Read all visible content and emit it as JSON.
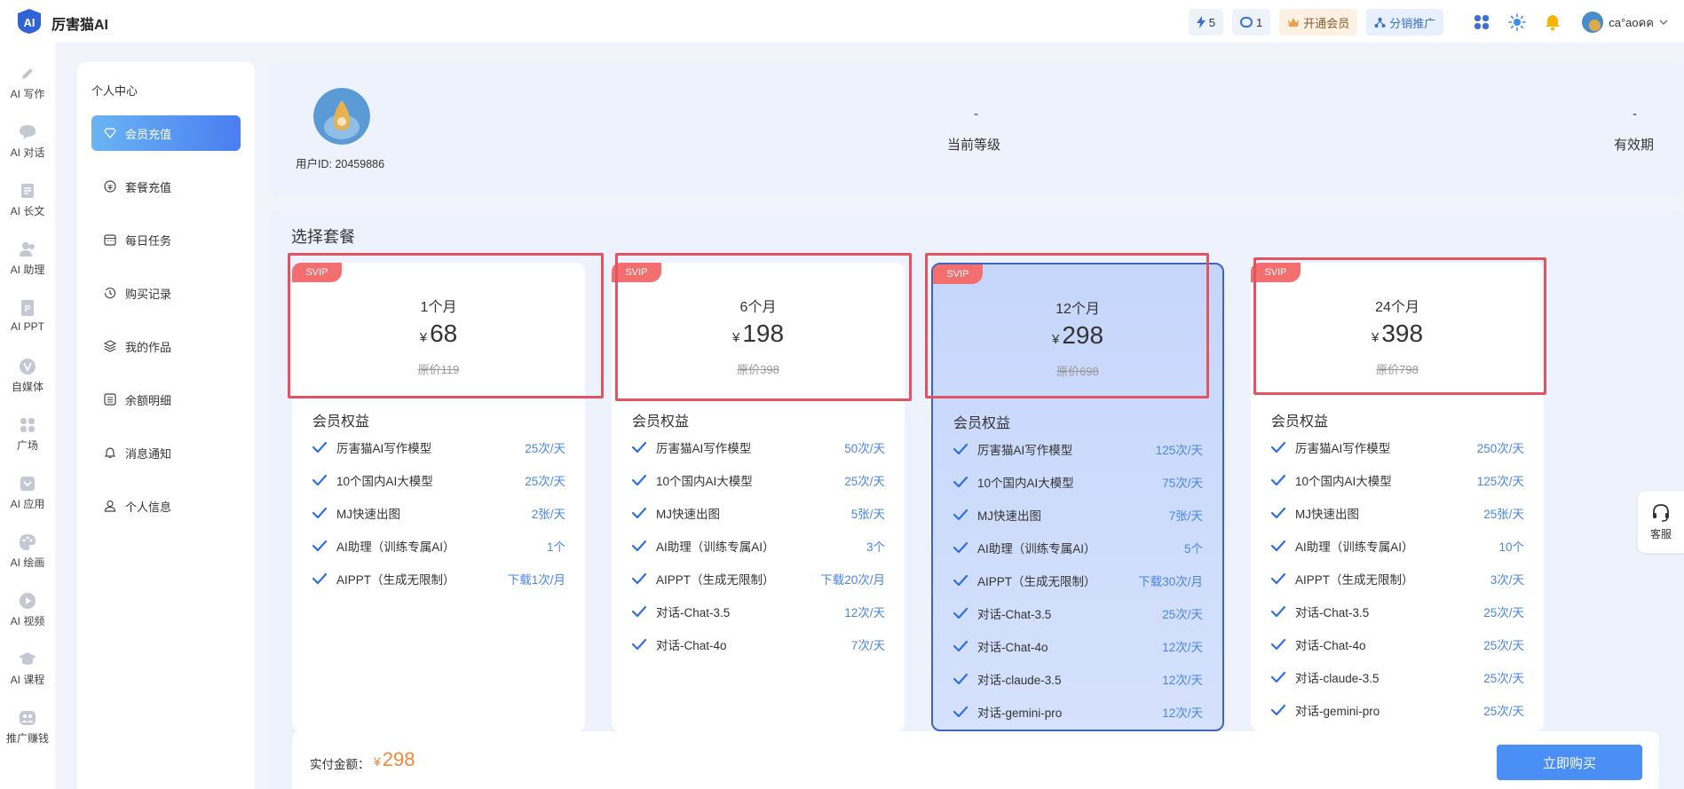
{
  "app": {
    "title": "厉害猫AI",
    "logo_text": "AI"
  },
  "topbar": {
    "energy_count": "5",
    "token_count": "1",
    "vip_label": "开通会员",
    "distribution_label": "分销推广",
    "username": "ca°aoคค"
  },
  "leftnav": [
    {
      "label": "AI 写作",
      "icon": "pencil-icon"
    },
    {
      "label": "AI 对话",
      "icon": "chat-bubble-icon"
    },
    {
      "label": "AI 长文",
      "icon": "document-icon"
    },
    {
      "label": "AI 助理",
      "icon": "assistant-icon"
    },
    {
      "label": "AI PPT",
      "icon": "ppt-icon"
    },
    {
      "label": "自媒体",
      "icon": "media-icon"
    },
    {
      "label": "广场",
      "icon": "grid-icon"
    },
    {
      "label": "AI 应用",
      "icon": "app-icon"
    },
    {
      "label": "AI 绘画",
      "icon": "palette-icon"
    },
    {
      "label": "AI 视频",
      "icon": "play-icon"
    },
    {
      "label": "AI 课程",
      "icon": "graduation-cap-icon"
    },
    {
      "label": "推广赚钱",
      "icon": "users-icon"
    }
  ],
  "menu": {
    "title": "个人中心",
    "items": [
      {
        "label": "会员充值",
        "icon": "diamond-icon",
        "active": true
      },
      {
        "label": "套餐充值",
        "icon": "coin-icon"
      },
      {
        "label": "每日任务",
        "icon": "calendar-icon"
      },
      {
        "label": "购买记录",
        "icon": "history-icon"
      },
      {
        "label": "我的作品",
        "icon": "layers-icon"
      },
      {
        "label": "余额明细",
        "icon": "list-icon"
      },
      {
        "label": "消息通知",
        "icon": "bell-icon"
      },
      {
        "label": "个人信息",
        "icon": "user-icon"
      }
    ]
  },
  "profile": {
    "user_id": "用户ID: 20459886",
    "level_value": "-",
    "level_label": "当前等级",
    "expiry_value": "-",
    "expiry_label": "有效期"
  },
  "packages_title": "选择套餐",
  "benefits_title": "会员权益",
  "badge": "SVIP",
  "currency": "¥",
  "packages": [
    {
      "name": "1个月",
      "price": "68",
      "original": "原价119",
      "selected": false,
      "benefits": [
        {
          "name": "厉害猫AI写作模型",
          "value": "25次/天"
        },
        {
          "name": "10个国内AI大模型",
          "value": "25次/天"
        },
        {
          "name": "MJ快速出图",
          "value": "2张/天"
        },
        {
          "name": "AI助理（训练专属AI）",
          "value": "1个"
        },
        {
          "name": "AIPPT（生成无限制）",
          "value": "下载1次/月"
        }
      ]
    },
    {
      "name": "6个月",
      "price": "198",
      "original": "原价398",
      "selected": false,
      "benefits": [
        {
          "name": "厉害猫AI写作模型",
          "value": "50次/天"
        },
        {
          "name": "10个国内AI大模型",
          "value": "25次/天"
        },
        {
          "name": "MJ快速出图",
          "value": "5张/天"
        },
        {
          "name": "AI助理（训练专属AI）",
          "value": "3个"
        },
        {
          "name": "AIPPT（生成无限制）",
          "value": "下载20次/月"
        },
        {
          "name": "对话-Chat-3.5",
          "value": "12次/天"
        },
        {
          "name": "对话-Chat-4o",
          "value": "7次/天"
        }
      ]
    },
    {
      "name": "12个月",
      "price": "298",
      "original": "原价698",
      "selected": true,
      "benefits": [
        {
          "name": "厉害猫AI写作模型",
          "value": "125次/天"
        },
        {
          "name": "10个国内AI大模型",
          "value": "75次/天"
        },
        {
          "name": "MJ快速出图",
          "value": "7张/天"
        },
        {
          "name": "AI助理（训练专属AI）",
          "value": "5个"
        },
        {
          "name": "AIPPT（生成无限制）",
          "value": "下载30次/月"
        },
        {
          "name": "对话-Chat-3.5",
          "value": "25次/天"
        },
        {
          "name": "对话-Chat-4o",
          "value": "12次/天"
        },
        {
          "name": "对话-claude-3.5",
          "value": "12次/天"
        },
        {
          "name": "对话-gemini-pro",
          "value": "12次/天"
        }
      ]
    },
    {
      "name": "24个月",
      "price": "398",
      "original": "原价798",
      "selected": false,
      "benefits": [
        {
          "name": "厉害猫AI写作模型",
          "value": "250次/天"
        },
        {
          "name": "10个国内AI大模型",
          "value": "125次/天"
        },
        {
          "name": "MJ快速出图",
          "value": "25张/天"
        },
        {
          "name": "AI助理（训练专属AI）",
          "value": "10个"
        },
        {
          "name": "AIPPT（生成无限制）",
          "value": "3次/天"
        },
        {
          "name": "对话-Chat-3.5",
          "value": "25次/天"
        },
        {
          "name": "对话-Chat-4o",
          "value": "25次/天"
        },
        {
          "name": "对话-claude-3.5",
          "value": "25次/天"
        },
        {
          "name": "对话-gemini-pro",
          "value": "25次/天"
        }
      ]
    }
  ],
  "payment": {
    "label": "实付金额：",
    "amount": "298",
    "buy_label": "立即购买"
  },
  "customer_service": {
    "label": "客服"
  },
  "colors": {
    "accent": "#4a8ff5",
    "badge": "#f36f6f",
    "highlight": "#e35463",
    "price": "#f0883a"
  }
}
